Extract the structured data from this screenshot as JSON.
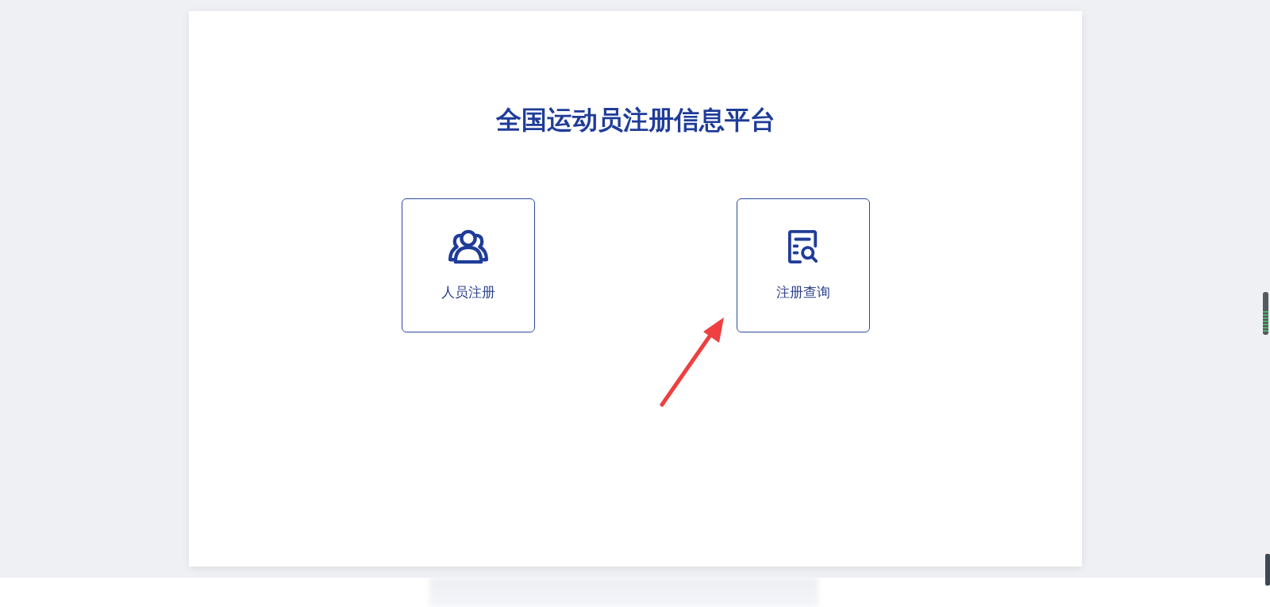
{
  "title": "全国运动员注册信息平台",
  "tiles": [
    {
      "label": "人员注册",
      "kind": "people"
    },
    {
      "label": "注册查询",
      "kind": "query"
    }
  ]
}
